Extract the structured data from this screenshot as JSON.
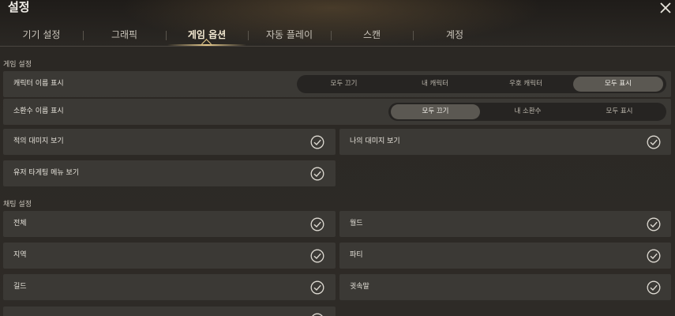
{
  "window": {
    "title": "설정"
  },
  "tabs": [
    {
      "label": "기기 설정"
    },
    {
      "label": "그래픽"
    },
    {
      "label": "게임 옵션"
    },
    {
      "label": "자동 플레이"
    },
    {
      "label": "스캔"
    },
    {
      "label": "계정"
    }
  ],
  "active_tab": "게임 옵션",
  "game_settings": {
    "section_title": "게임 설정",
    "character_name": {
      "label": "캐릭터 이름 표시",
      "options": [
        "모두 끄기",
        "내 캐릭터",
        "우호 캐릭터",
        "모두 표시"
      ],
      "selected": "모두 표시"
    },
    "summon_name": {
      "label": "소환수 이름 표시",
      "options": [
        "모두 끄기",
        "내 소환수",
        "모두 표시"
      ],
      "selected": "모두 끄기"
    },
    "enemy_damage": {
      "label": "적의 대미지 보기",
      "checked": true
    },
    "my_damage": {
      "label": "나의 대미지 보기",
      "checked": true
    },
    "user_targeting": {
      "label": "유저 타게팅 메뉴 보기",
      "checked": true
    }
  },
  "chat_settings": {
    "section_title": "채팅 설정",
    "all": {
      "label": "전체",
      "checked": true
    },
    "world": {
      "label": "월드",
      "checked": true
    },
    "region": {
      "label": "지역",
      "checked": true
    },
    "party": {
      "label": "파티",
      "checked": true
    },
    "guild": {
      "label": "길드",
      "checked": true
    },
    "whisper": {
      "label": "귓속말",
      "checked": true
    }
  },
  "colors": {
    "accent": "#e8cc8e",
    "row_bg": "#3b3935",
    "panel_bg": "#2e2b27"
  }
}
